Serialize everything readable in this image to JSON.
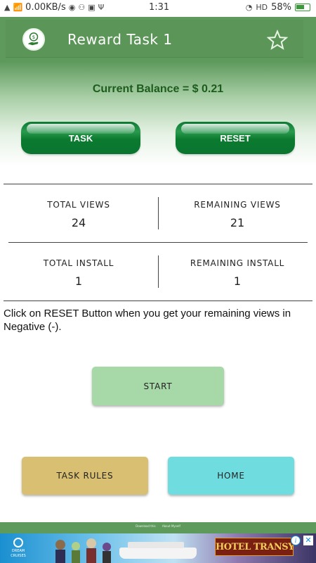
{
  "status_bar": {
    "network_speed": "0.00KB/s",
    "time": "1:31",
    "network_type": "HD",
    "battery": "58%"
  },
  "header": {
    "title": "Reward Task 1",
    "logo_icon": "money-hand-icon",
    "favorite_icon": "star-icon"
  },
  "balance": {
    "text": "Current Balance = $ 0.21"
  },
  "actions": {
    "task_label": "TASK",
    "reset_label": "RESET"
  },
  "stats": {
    "total_views_label": "TOTAL VIEWS",
    "total_views_value": "24",
    "remaining_views_label": "REMAINING VIEWS",
    "remaining_views_value": "21",
    "total_install_label": "TOTAL INSTALL",
    "total_install_value": "1",
    "remaining_install_label": "REMAINING INSTALL",
    "remaining_install_value": "1"
  },
  "note": "Click on RESET Button when you get your remaining views in Negative (-).",
  "buttons": {
    "start_label": "START",
    "task_rules_label": "TASK RULES",
    "home_label": "HOME"
  },
  "footer": {
    "link_1": "Download this",
    "link_2": "About Myself"
  },
  "ad": {
    "brand": "DREAM CRUISES",
    "movie_title": "HOTEL TRANSYLVANIA",
    "info_icon": "i",
    "close_icon": "✕"
  },
  "colors": {
    "header_green": "#5e9a5c",
    "balance_text": "#1c5c1c",
    "task_button": "#0b7a2f",
    "start_button": "#a6d9a7",
    "task_rules_button": "#d9bf72",
    "home_button": "#6fdde0"
  }
}
